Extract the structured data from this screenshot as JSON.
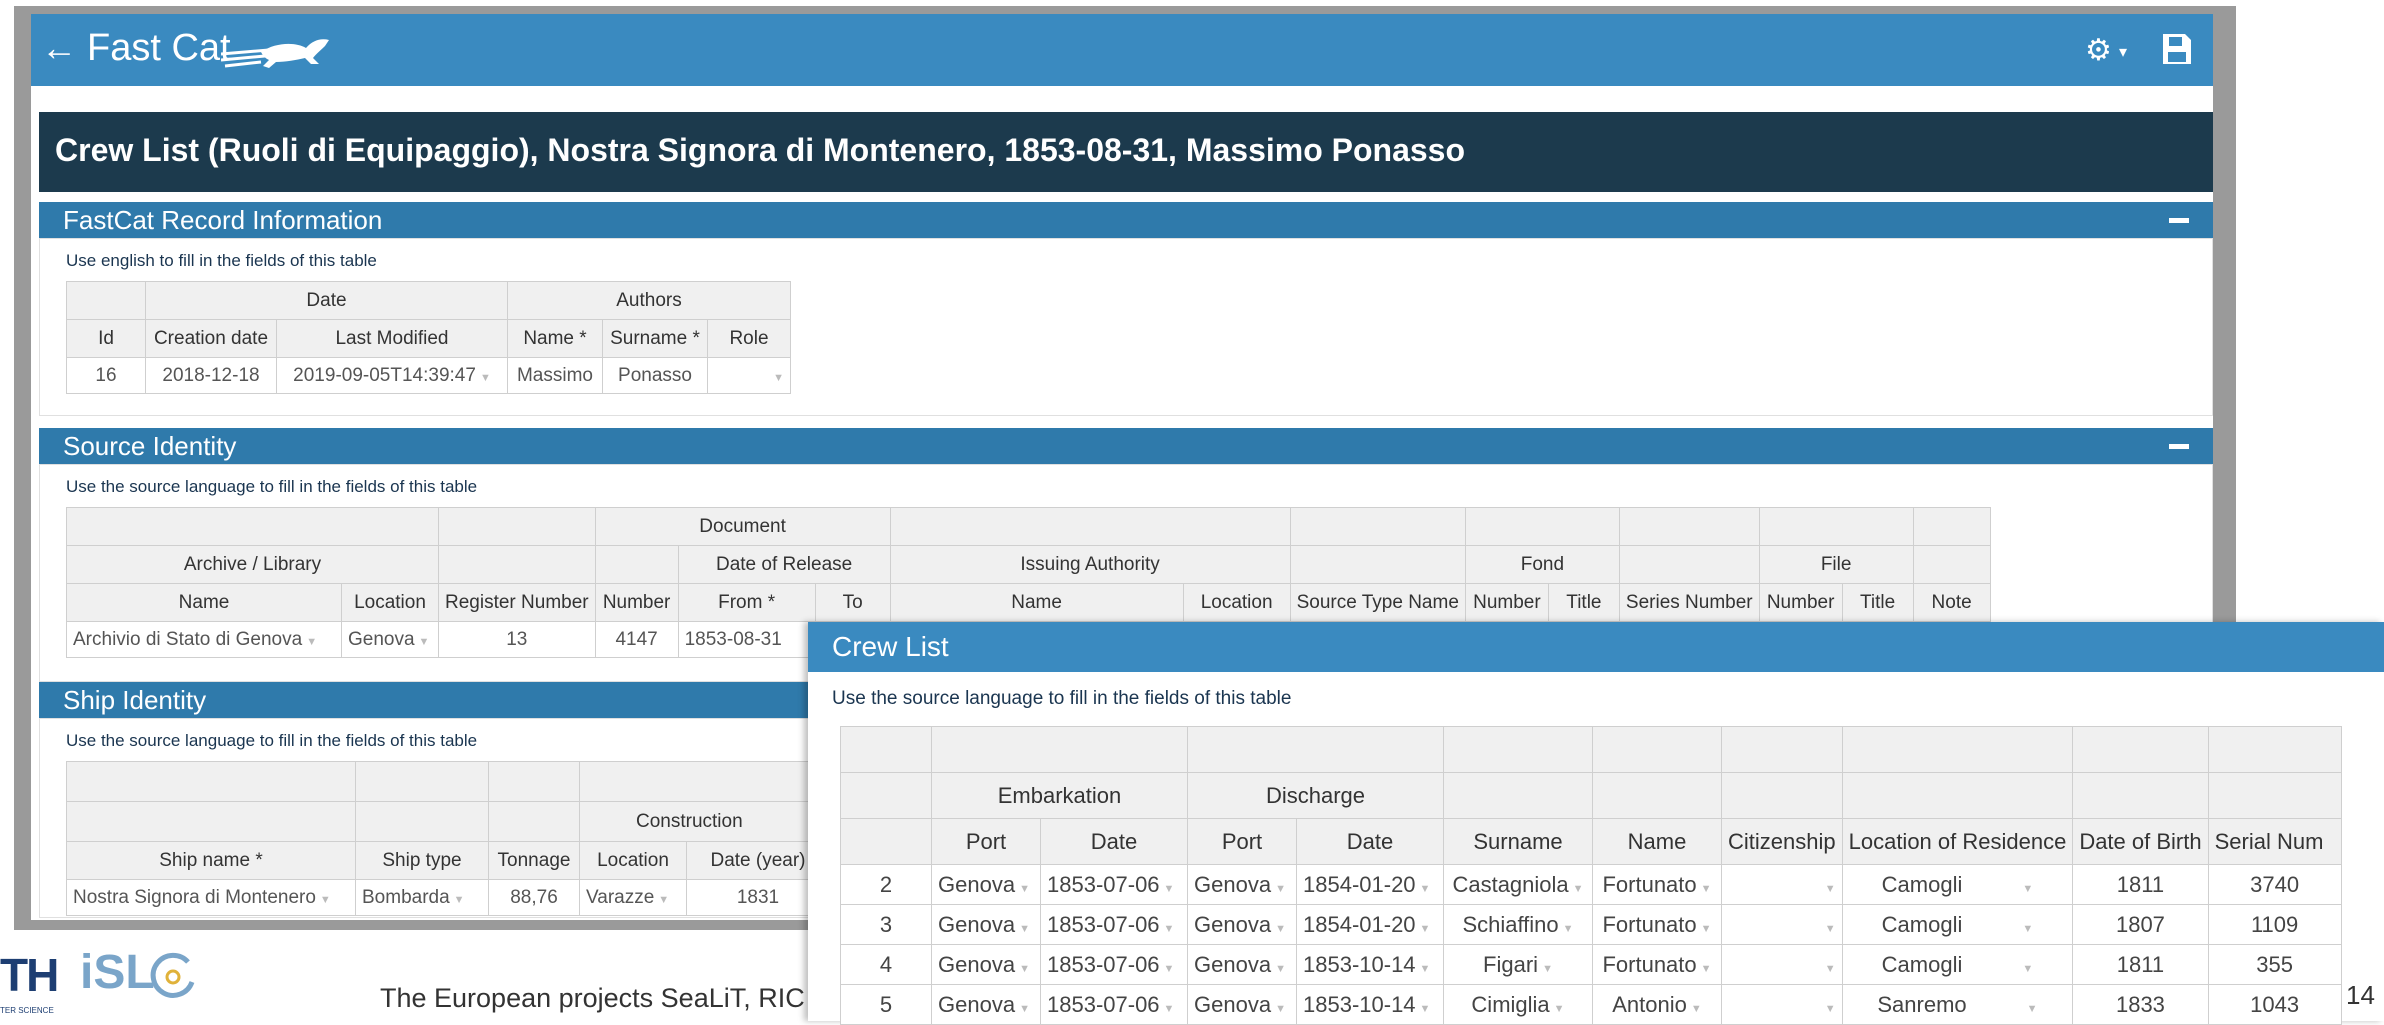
{
  "app": {
    "brand": "Fast Cat",
    "back_icon": "←",
    "gear_icon": "⚙",
    "caret": "▾",
    "accent": "#3a8ac0",
    "title_bg": "#1c3a4d"
  },
  "page_title": "Crew List (Ruoli di Equipaggio), Nostra Signora di Montenero, 1853-08-31, Massimo Ponasso",
  "record": {
    "title": "FastCat Record Information",
    "hint": "Use english to fill in the fields of this table",
    "group_date": "Date",
    "group_authors": "Authors",
    "col_id": "Id",
    "col_creation": "Creation date",
    "col_modified": "Last Modified",
    "col_name": "Name *",
    "col_surname": "Surname *",
    "col_role": "Role",
    "row": {
      "id": "16",
      "creation": "2018-12-18",
      "modified": "2019-09-05T14:39:47",
      "name": "Massimo",
      "surname": "Ponasso",
      "role": ""
    }
  },
  "source": {
    "title": "Source Identity",
    "hint": "Use the source language to fill in the fields of this table",
    "group_document": "Document",
    "group_archive": "Archive / Library",
    "group_release": "Date of Release",
    "group_issuing": "Issuing Authority",
    "group_fond": "Fond",
    "group_file": "File",
    "cols": [
      "Name",
      "Location",
      "Register Number",
      "Number",
      "From *",
      "To",
      "Name",
      "Location",
      "Source Type Name",
      "Number",
      "Title",
      "Series Number",
      "Number",
      "Title",
      "Note"
    ],
    "row": {
      "archive": "Archivio di Stato di Genova",
      "location": "Genova",
      "register": "13",
      "number": "4147",
      "from": "1853-08-31"
    }
  },
  "ship": {
    "title": "Ship Identity",
    "hint": "Use the source language to fill in the fields of this table",
    "group_construction": "Construction",
    "cols": [
      "Ship name *",
      "Ship type",
      "Tonnage",
      "Location",
      "Date (year)"
    ],
    "row": {
      "name": "Nostra Signora di Montenero",
      "type": "Bombarda",
      "tonnage": "88,76",
      "location": "Varazze",
      "year": "1831"
    }
  },
  "crew": {
    "title": "Crew List",
    "hint": "Use the source language to fill in the fields of this table",
    "group_embarkation": "Embarkation",
    "group_discharge": "Discharge",
    "cols": [
      "Port",
      "Date",
      "Port",
      "Date",
      "Surname",
      "Name",
      "Citizenship",
      "Location of Residence",
      "Date of Birth",
      "Serial Num"
    ],
    "rows": [
      {
        "n": "2",
        "emb_port": "Genova",
        "emb_date": "1853-07-06",
        "dis_port": "Genova",
        "dis_date": "1854-01-20",
        "surname": "Castagniola",
        "name": "Fortunato",
        "citizenship": "",
        "residence": "Camogli",
        "birth": "1811",
        "serial": "3740"
      },
      {
        "n": "3",
        "emb_port": "Genova",
        "emb_date": "1853-07-06",
        "dis_port": "Genova",
        "dis_date": "1854-01-20",
        "surname": "Schiaffino",
        "name": "Fortunato",
        "citizenship": "",
        "residence": "Camogli",
        "birth": "1807",
        "serial": "1109"
      },
      {
        "n": "4",
        "emb_port": "Genova",
        "emb_date": "1853-07-06",
        "dis_port": "Genova",
        "dis_date": "1853-10-14",
        "surname": "Figari",
        "name": "Fortunato",
        "citizenship": "",
        "residence": "Camogli",
        "birth": "1811",
        "serial": "355"
      },
      {
        "n": "5",
        "emb_port": "Genova",
        "emb_date": "1853-07-06",
        "dis_port": "Genova",
        "dis_date": "1853-10-14",
        "surname": "Cimiglia",
        "name": "Antonio",
        "citizenship": "",
        "residence": "Sanremo",
        "birth": "1833",
        "serial": "1043"
      }
    ]
  },
  "footer": {
    "text": "The European projects SeaLiT, RIC",
    "page": "14",
    "logo_th": "TH",
    "logo_sub": "TER SCIENCE",
    "logo_isl": "iSL"
  }
}
